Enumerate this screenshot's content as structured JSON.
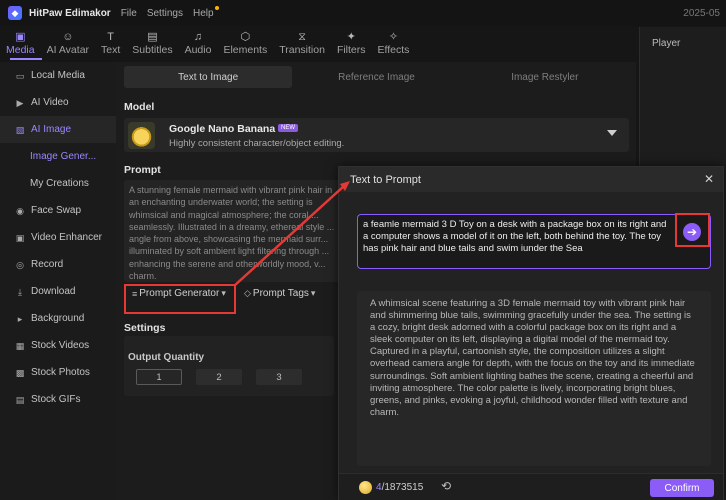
{
  "app": {
    "name": "HitPaw Edimakor",
    "menu": [
      "File",
      "Settings",
      "Help"
    ],
    "date": "2025-05"
  },
  "toolbar": {
    "tabs": [
      {
        "label": "Media",
        "icon": "media-icon"
      },
      {
        "label": "AI Avatar",
        "icon": "ai-avatar-icon"
      },
      {
        "label": "Text",
        "icon": "text-icon"
      },
      {
        "label": "Subtitles",
        "icon": "subtitles-icon"
      },
      {
        "label": "Audio",
        "icon": "audio-icon"
      },
      {
        "label": "Elements",
        "icon": "elements-icon"
      },
      {
        "label": "Transition",
        "icon": "transition-icon"
      },
      {
        "label": "Filters",
        "icon": "filters-icon"
      },
      {
        "label": "Effects",
        "icon": "effects-icon"
      }
    ],
    "active": "Media"
  },
  "sidebar": {
    "items": [
      {
        "label": "Local Media",
        "icon": "folder-icon"
      },
      {
        "label": "AI Video",
        "icon": "video-icon"
      },
      {
        "label": "AI Image",
        "icon": "image-icon"
      },
      {
        "label": "Image Gener...",
        "icon": ""
      },
      {
        "label": "My Creations",
        "icon": ""
      },
      {
        "label": "Face Swap",
        "icon": "face-swap-icon"
      },
      {
        "label": "Video Enhancer",
        "icon": "enhancer-icon"
      },
      {
        "label": "Record",
        "icon": "record-icon"
      },
      {
        "label": "Download",
        "icon": "download-icon"
      },
      {
        "label": "Background",
        "icon": "background-icon"
      },
      {
        "label": "Stock Videos",
        "icon": "stock-video-icon"
      },
      {
        "label": "Stock Photos",
        "icon": "stock-photo-icon"
      },
      {
        "label": "Stock GIFs",
        "icon": "gif-icon"
      }
    ]
  },
  "main": {
    "subtabs": [
      "Text to Image",
      "Reference Image",
      "Image Restyler"
    ],
    "model_label": "Model",
    "model_name": "Google Nano Banana",
    "model_badge": "NEW",
    "model_desc": "Highly consistent character/object editing.",
    "prompt_label": "Prompt",
    "prompt_text": "A stunning female mermaid with vibrant pink hair in an enchanting underwater world; the setting is whimsical and magical atmosphere; the coral ... seamlessly. Illustrated in a dreamy, ethereal style ... angle from above, showcasing the mermaid surr... illuminated by soft ambient light filtering through ... enhancing the serene and otherworldly mood, v... charm.",
    "prompt_generator": "Prompt Generator",
    "prompt_tags": "Prompt Tags",
    "settings_label": "Settings",
    "output_quantity_label": "Output Quantity",
    "quantities": [
      "1",
      "2",
      "3"
    ]
  },
  "player": {
    "title": "Player"
  },
  "dialog": {
    "title": "Text to Prompt",
    "input": "a feamle mermaid 3 D Toy on a desk with a package box on its right and a computer shows a model of it on the left, both behind the toy. The toy has pink hair and blue tails and swim iunder the Sea",
    "result": "A whimsical scene featuring a 3D female mermaid toy with vibrant pink hair and shimmering blue tails, swimming gracefully under the sea. The setting is a cozy, bright desk adorned with a colorful package box on its right and a sleek computer on its left, displaying a digital model of the mermaid toy. Captured in a playful, cartoonish style, the composition utilizes a slight overhead camera angle for depth, with the focus on the toy and its immediate surroundings. Soft ambient lighting bathes the scene, creating a cheerful and inviting atmosphere. The color palette is lively, incorporating bright blues, greens, and pinks, evoking a joyful, childhood wonder filled with texture and charm.",
    "credits_used": "4",
    "credits_total": "/1873515",
    "confirm": "Confirm"
  },
  "colors": {
    "accent": "#8c5cf6",
    "highlight_box": "#e53935"
  }
}
